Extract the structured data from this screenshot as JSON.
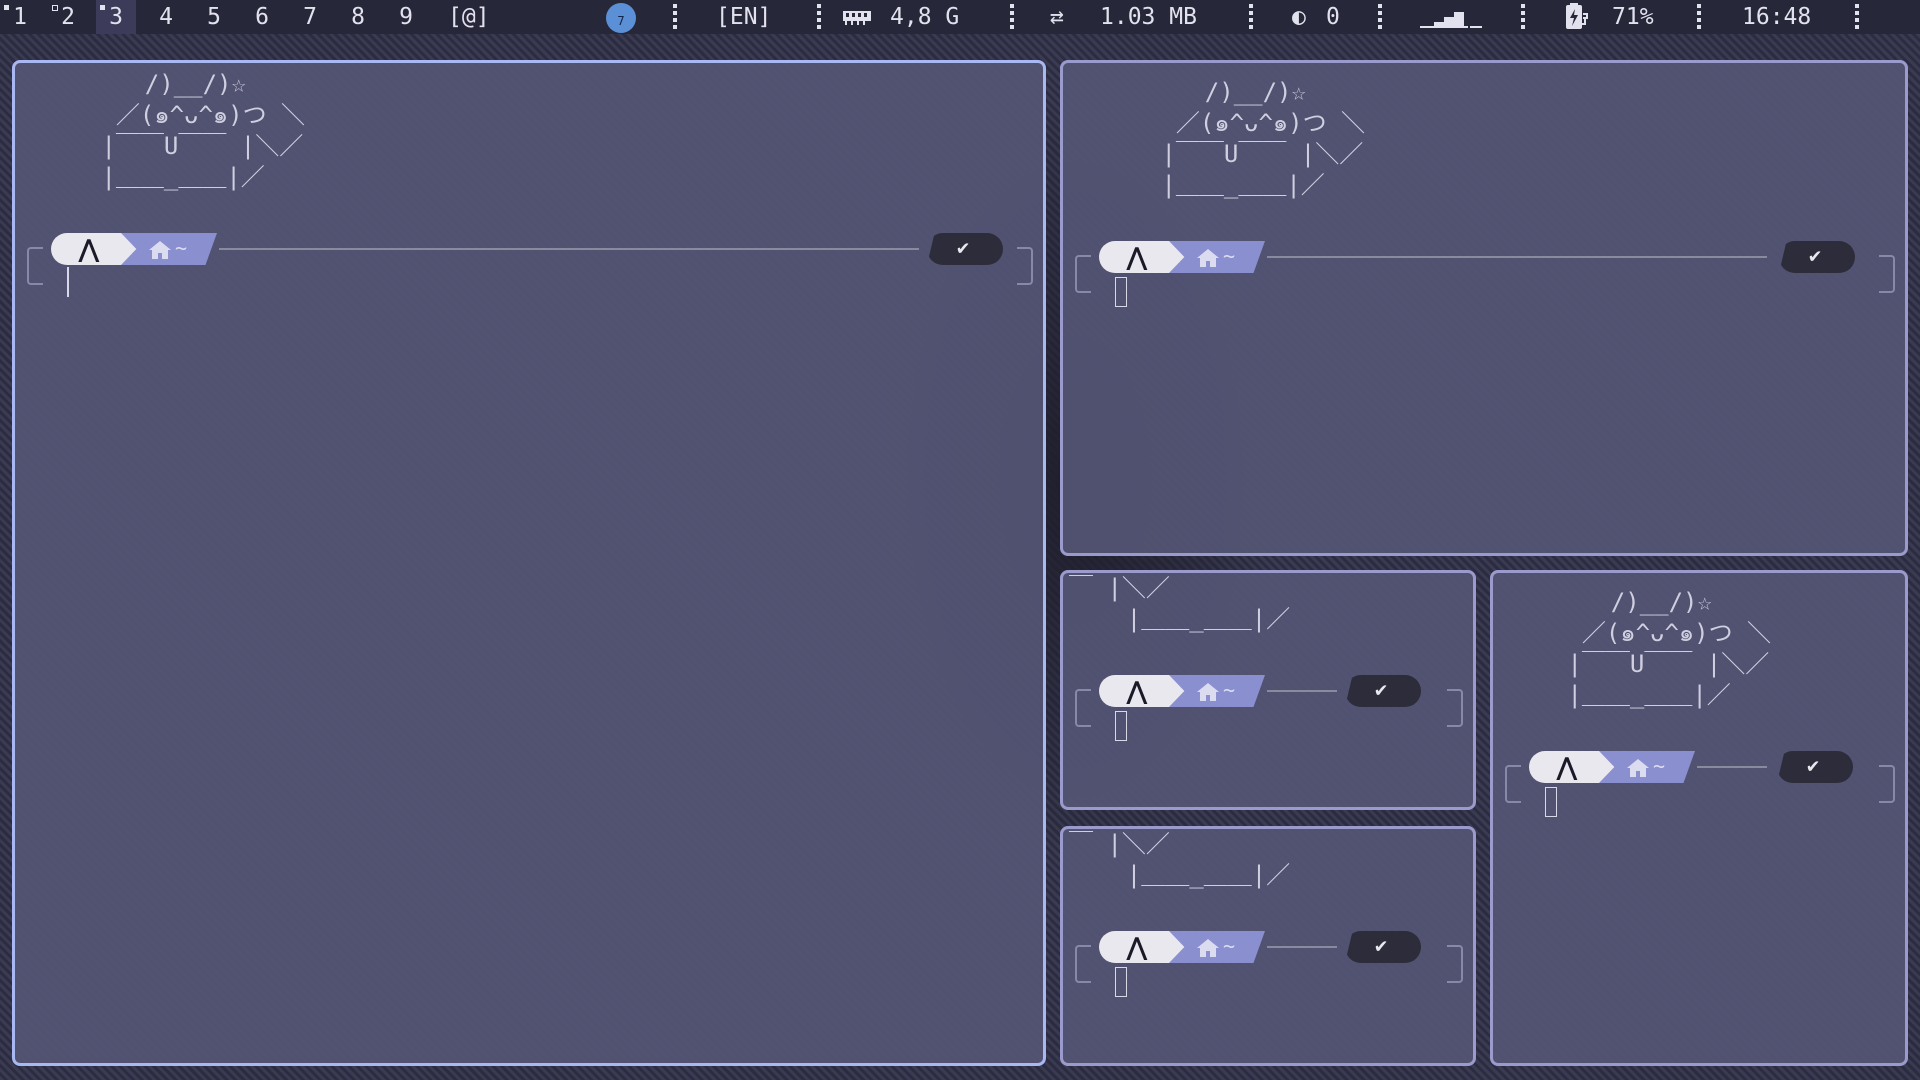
{
  "topbar": {
    "workspaces": [
      {
        "label": "1",
        "mark": "filled"
      },
      {
        "label": "2",
        "mark": "hollow"
      },
      {
        "label": "3",
        "mark": "filled",
        "active": true
      },
      {
        "label": "4"
      },
      {
        "label": "5"
      },
      {
        "label": "6"
      },
      {
        "label": "7"
      },
      {
        "label": "8"
      },
      {
        "label": "9"
      }
    ],
    "layout_indicator": "[@]",
    "tray_badge": "7",
    "keyboard_layout": "[EN]",
    "memory_icon": "ram-icon",
    "memory": "4,8 G",
    "network_icon": "transfer-arrows-icon",
    "network": "1.03 MB",
    "moon_icon": "moon-icon",
    "moon_count": "0",
    "signal_icon": "signal-bars-icon",
    "battery_icon": "battery-charging-icon",
    "battery": "71%",
    "clock": "16:48",
    "bar_bg": "#27273a",
    "fg": "#e2e2ee"
  },
  "ascii": {
    "cat_full": "    /)__/)☆\n  ／(๑^ᴗ^๑)つ ＼\n |￣￣U￣￣ |＼／\n |＿＿_＿＿|／",
    "cat_cut": "￣ |＼／\n    |＿＿_＿＿|／"
  },
  "prompt": {
    "os_icon": "arch-linux-icon",
    "os_glyph": "⋀",
    "home_icon": "home-icon",
    "path": "~",
    "status": "✔"
  },
  "colors": {
    "window_bg": "#545474",
    "border": "#9a9acc",
    "focused_border": "#a9b7f2",
    "path_segment": "#8a8fd0",
    "status_segment": "#2c2c3a"
  }
}
